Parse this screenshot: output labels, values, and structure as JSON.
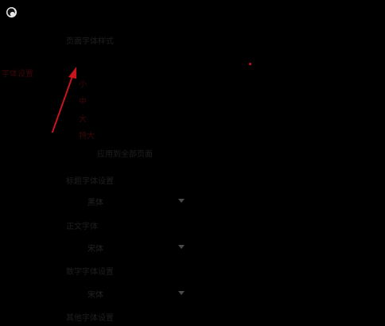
{
  "app": {
    "logo_icon": "app-logo-icon"
  },
  "sidebar": {
    "active_item": "字体设置"
  },
  "page_font": {
    "title": "页面字体样式",
    "options": [
      "小",
      "中",
      "大",
      "特大"
    ],
    "apply_label": "应用到全部页面"
  },
  "title_font": {
    "label": "标题字体设置",
    "value": "黑体"
  },
  "body_font": {
    "label": "正文字体",
    "value": "宋体"
  },
  "number_font": {
    "label": "数字字体设置",
    "value": "宋体"
  },
  "other_font": {
    "label": "其他字体设置"
  },
  "colors": {
    "background": "#000000",
    "text": "#1e1e1e",
    "accent_red": "#d0101a",
    "dim_red": "#3c0707"
  }
}
